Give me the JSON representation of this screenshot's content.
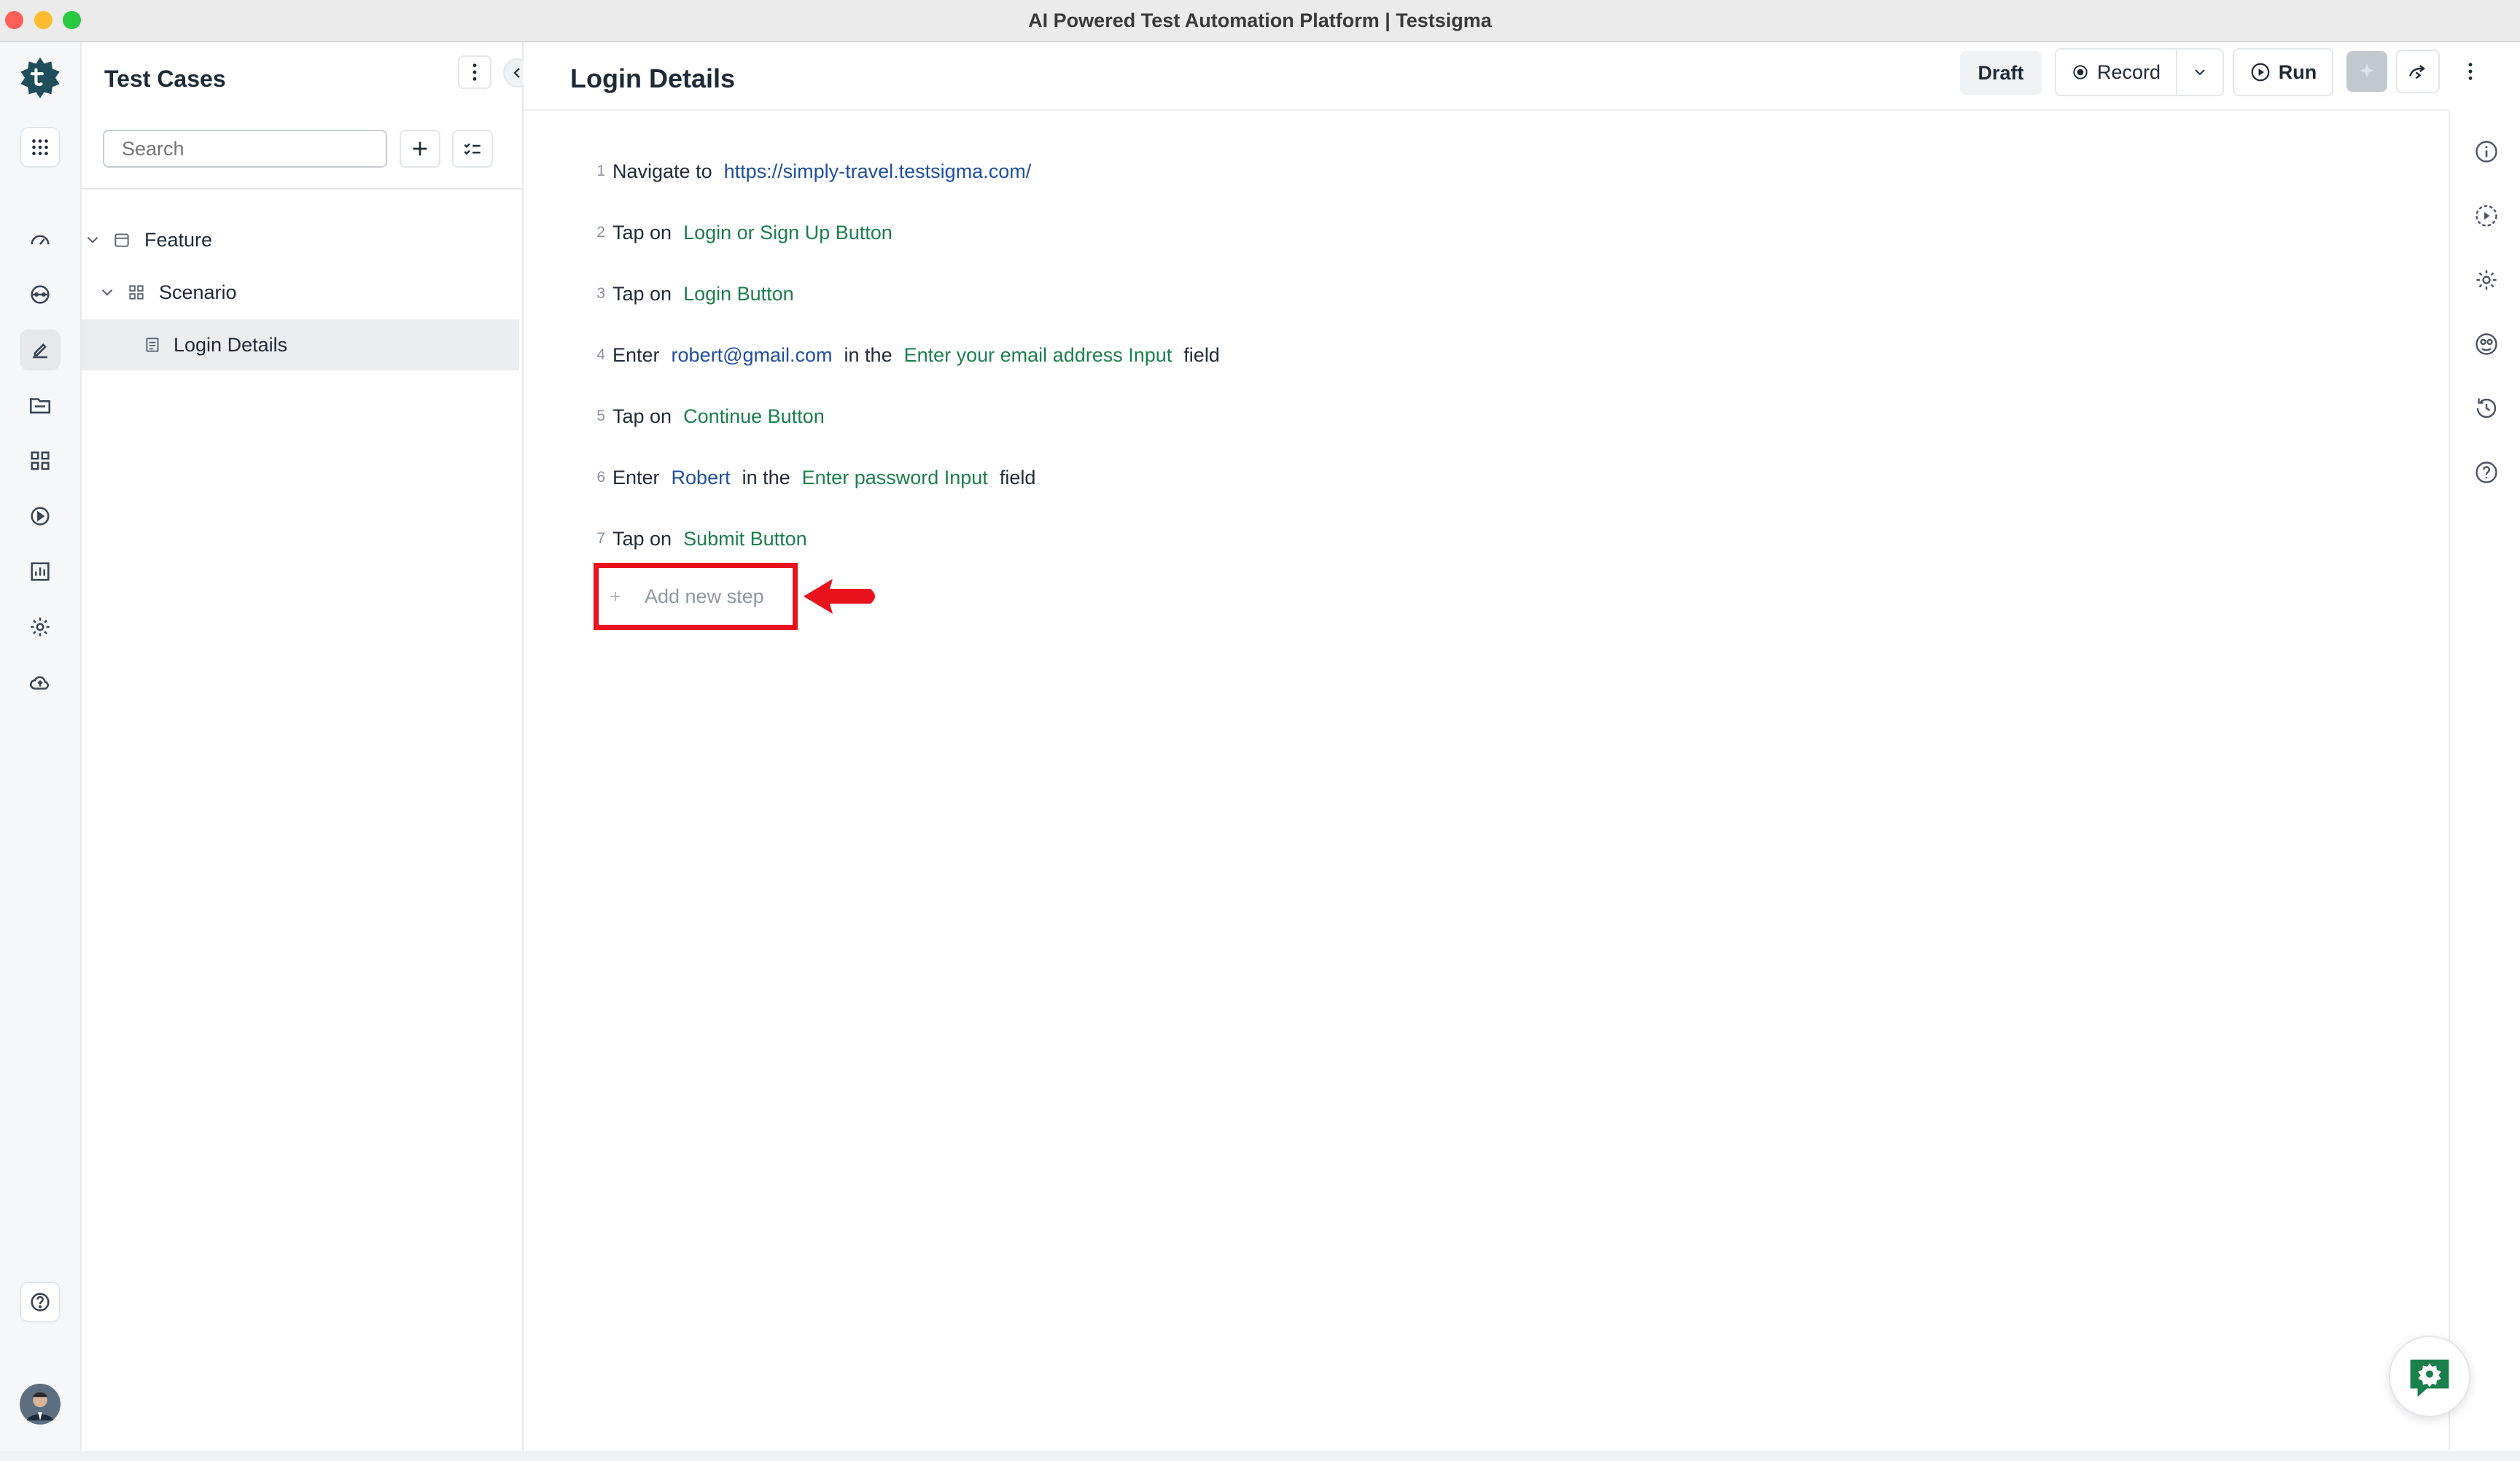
{
  "window": {
    "title": "AI Powered Test Automation Platform | Testsigma"
  },
  "panel": {
    "title": "Test Cases",
    "search_placeholder": "Search",
    "tree": [
      {
        "label": "Feature",
        "icon": "feature-icon",
        "level": 0,
        "expanded": true
      },
      {
        "label": "Scenario",
        "icon": "scenario-icon",
        "level": 1,
        "expanded": true
      },
      {
        "label": "Login Details",
        "icon": "test-case-icon",
        "level": 2,
        "selected": true
      }
    ]
  },
  "header": {
    "title": "Login Details",
    "status": "Draft",
    "record_label": "Record",
    "run_label": "Run"
  },
  "steps": [
    {
      "num": "1",
      "parts": [
        {
          "t": "Navigate to",
          "k": "act"
        },
        {
          "t": "https://simply-travel.testsigma.com/",
          "k": "tdata"
        }
      ]
    },
    {
      "num": "2",
      "parts": [
        {
          "t": "Tap on",
          "k": "act"
        },
        {
          "t": "Login or Sign Up Button",
          "k": "ele"
        }
      ]
    },
    {
      "num": "3",
      "parts": [
        {
          "t": "Tap on",
          "k": "act"
        },
        {
          "t": "Login Button",
          "k": "ele"
        }
      ]
    },
    {
      "num": "4",
      "parts": [
        {
          "t": "Enter",
          "k": "act"
        },
        {
          "t": "robert@gmail.com",
          "k": "tdata"
        },
        {
          "t": "in the",
          "k": "act"
        },
        {
          "t": "Enter your email address Input",
          "k": "ele"
        },
        {
          "t": "field",
          "k": "act"
        }
      ]
    },
    {
      "num": "5",
      "parts": [
        {
          "t": "Tap on",
          "k": "act"
        },
        {
          "t": "Continue Button",
          "k": "ele"
        }
      ]
    },
    {
      "num": "6",
      "parts": [
        {
          "t": "Enter",
          "k": "act"
        },
        {
          "t": "Robert",
          "k": "tdata"
        },
        {
          "t": "in the",
          "k": "act"
        },
        {
          "t": "Enter password Input",
          "k": "ele"
        },
        {
          "t": "field",
          "k": "act"
        }
      ]
    },
    {
      "num": "7",
      "parts": [
        {
          "t": "Tap on",
          "k": "act"
        },
        {
          "t": "Submit Button",
          "k": "ele"
        }
      ]
    }
  ],
  "add_step": {
    "label": "Add new step"
  },
  "colors": {
    "brand": "#1e4d5c",
    "element": "#1a7f4b",
    "test_data": "#1f4fa0",
    "annotation": "#e8121d"
  }
}
